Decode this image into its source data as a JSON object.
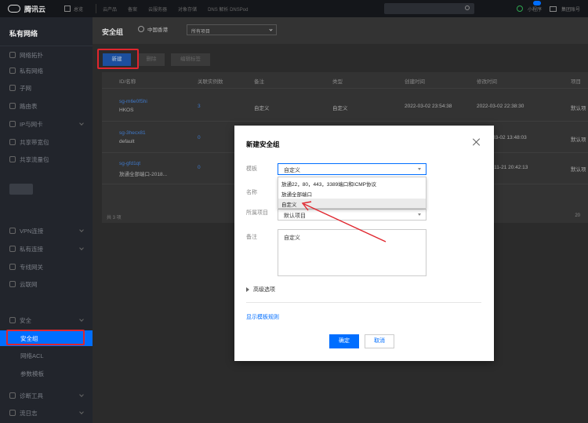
{
  "topbar": {
    "brand": "腾讯云",
    "home": "总览",
    "nav": [
      "云产品",
      "备案",
      "云服务器",
      "对象存储",
      "DNS 解析 DNSPod"
    ],
    "mini_program": "小程序",
    "user": "集团账号"
  },
  "sidebar": {
    "title": "私有网络",
    "items": [
      "网络拓扑",
      "私有网络",
      "子网",
      "路由表",
      "IP与网卡",
      "共享带宽包",
      "共享流量包"
    ],
    "items2": [
      "VPN连接",
      "私有连接",
      "专线网关",
      "云联网"
    ],
    "group_security": "安全",
    "security_sub": [
      "安全组",
      "网络ACL",
      "参数模板"
    ],
    "bottom": [
      "诊断工具",
      "流日志"
    ]
  },
  "main": {
    "title": "安全组",
    "region": "中国香港",
    "project": "所有项目",
    "btn_new": "新建",
    "btn_2": "删除",
    "btn_3": "编辑标签",
    "columns": [
      "ID/名称",
      "关联实例数",
      "备注",
      "类型",
      "创建时间",
      "修改时间",
      "项目"
    ],
    "rows": [
      {
        "id": "sg-m6e0f5hi",
        "name": "HKOS",
        "count": "3",
        "note": "自定义",
        "type": "自定义",
        "created": "2022-03-02 23:54:38",
        "modified": "2022-03-02 22:38:30",
        "project": "默认项"
      },
      {
        "id": "sg-3hecx81",
        "name": "default",
        "count": "0",
        "note": "",
        "type": "",
        "created": "",
        "modified": "03-02 13:48:03",
        "project": "默认项"
      },
      {
        "id": "sg-gfd1qt",
        "name": "放通全部端口-2018...",
        "count": "0",
        "note": "",
        "type": "",
        "created": "",
        "modified": "-11-21 20:42:13",
        "project": "默认项"
      }
    ],
    "pager_left": "共 3 项",
    "pager_right": "20"
  },
  "modal": {
    "title": "新建安全组",
    "label_template": "模板",
    "template_value": "自定义",
    "template_options": [
      "放通22，80，443，3389端口和ICMP协议",
      "放通全部端口",
      "自定义"
    ],
    "label_name": "名称",
    "label_project": "所属项目",
    "project_value": "默认项目",
    "label_note": "备注",
    "note_value": "自定义",
    "advanced": "高级选项",
    "show_rules": "显示模板规则",
    "ok": "确定",
    "cancel": "取消"
  },
  "colors": {
    "accent": "#006eff",
    "highlight": "#e0262e"
  }
}
